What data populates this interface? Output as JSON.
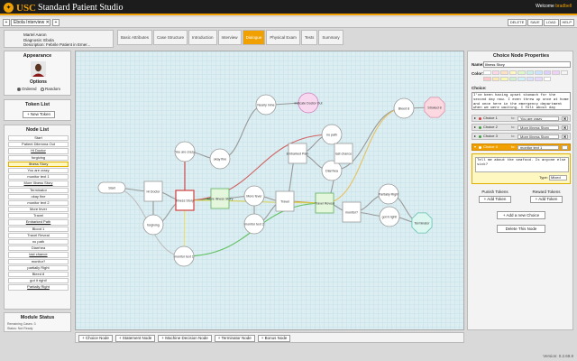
{
  "header": {
    "brand": "USC",
    "app_name": "Standard Patient Studio",
    "welcome_prefix": "Welcome",
    "username": "bradbell",
    "actions": [
      "DELETE",
      "SAVE",
      "LOAD",
      "HELP"
    ]
  },
  "scenario_tabs": {
    "add_label": "+",
    "current": "Ebola Interview",
    "current_marker": "✕",
    "new_label": "+"
  },
  "case_info": {
    "name": "Martel Aaron",
    "diagnosis": "Diagnosis: Ebola",
    "description": "Description: Febrile Patient in Emer..."
  },
  "section_tabs": [
    "Basic Attributes",
    "Case Structure",
    "Introduction",
    "Interview",
    "Dialogue",
    "Physical Exam",
    "Tests",
    "Summary"
  ],
  "active_section": "Dialogue",
  "left": {
    "appearance_title": "Appearance",
    "options_title": "Options",
    "option_ordered": "Ordered",
    "option_random": "Random",
    "tokens_title": "Token List",
    "new_token_label": "+ New Token",
    "node_list_title": "Node List",
    "nodes": [
      "Start",
      "Patient Dilemma Out",
      "Hi Doctor",
      "forgiving",
      "Illness Story",
      "You are crazy",
      "monitor text 1",
      "More Illness Story",
      "Terminator",
      "okay fine",
      "monitor text 2",
      "More fever",
      "Travel",
      "Embarked Path",
      "Blood 1",
      "Travel Reveal",
      "no path",
      "Diarrhea",
      "last chance",
      "monitor?",
      "partially Right",
      "Bleed 8",
      "got it right!",
      "Partially Right"
    ],
    "selected_node": "Illness Story",
    "module_status_title": "Module Status",
    "status_lines": [
      "Remaining Cases: 3",
      "Status: Not Ready"
    ]
  },
  "canvas": {
    "nodes": [
      {
        "label": "Start",
        "shape": "pill"
      },
      {
        "label": "Hi Doctor",
        "shape": "rect"
      },
      {
        "label": "forgiving",
        "shape": "circle"
      },
      {
        "label": "Illness Story",
        "shape": "rect-selected"
      },
      {
        "label": "You are crazy",
        "shape": "circle"
      },
      {
        "label": "okay fine",
        "shape": "circle"
      },
      {
        "label": "More Illness Story",
        "shape": "rect-green"
      },
      {
        "label": "monitor text 1",
        "shape": "circle"
      },
      {
        "label": "Nearly mine",
        "shape": "circle"
      },
      {
        "label": "Indicate Doctor Out",
        "shape": "circle-pink"
      },
      {
        "label": "More fever",
        "shape": "circle"
      },
      {
        "label": "monitor text 2",
        "shape": "circle"
      },
      {
        "label": "Travel",
        "shape": "rect"
      },
      {
        "label": "Embarked Path",
        "shape": "rect"
      },
      {
        "label": "no path",
        "shape": "circle"
      },
      {
        "label": "Diarrhea",
        "shape": "circle"
      },
      {
        "label": "last chance",
        "shape": "rect"
      },
      {
        "label": "Travel Reveal",
        "shape": "rect-green"
      },
      {
        "label": "monitor?",
        "shape": "rect"
      },
      {
        "label": "Bleed 8",
        "shape": "circle"
      },
      {
        "label": "Stroked 8",
        "shape": "oct-pink"
      },
      {
        "label": "Partially Right",
        "shape": "circle"
      },
      {
        "label": "Terminator",
        "shape": "oct-teal"
      },
      {
        "label": "got it right!",
        "shape": "circle"
      }
    ]
  },
  "bottom_buttons": [
    "+ Choice Node",
    "+ Statement Node",
    "+ Machine Decision Node",
    "+ Terminator Node",
    "+ Bonus Node"
  ],
  "right": {
    "title": "Choice Node Properties",
    "name_label": "Name:",
    "name_value": "Illness Story",
    "color_label": "Color:",
    "swatches": [
      "#ffffff",
      "#ffd6e8",
      "#ffe0c0",
      "#fff6c0",
      "#e0f6c8",
      "#c8f0e8",
      "#c8e4ff",
      "#dcd0ff",
      "#f0d0f8",
      "#f5f5f5",
      "#ffc8c8",
      "#ffe8b0",
      "#f8f8b0",
      "#d0f0d0",
      "#d0f0f8",
      "#d8e0ff",
      "#e8d8ff",
      "#ffffff"
    ],
    "choice_label": "Choice:",
    "choice_text": "I've been having upset stomach for the second day now. I even threw up once at home and once here in the emergency department when we were waiting. I felt about day",
    "choices": [
      {
        "label": "Choice 1",
        "to": "to:",
        "target": "You are crazy",
        "dot": "#d04040"
      },
      {
        "label": "Choice 2",
        "to": "to:",
        "target": "More Illness Story",
        "dot": "#40a040"
      },
      {
        "label": "Choice 3",
        "to": "to:",
        "target": "More Illness Story",
        "dot": "#40a040"
      },
      {
        "label": "Choice 4",
        "to": "to:",
        "target": "monitor text 1",
        "dot": "#ffffff"
      }
    ],
    "choice4_text": "Tell me about the seafood. Is anyone else sick?",
    "type_label": "Type:",
    "type_value": "Mixed",
    "punish_label": "Punish Tokens",
    "reward_label": "Reward Tokens",
    "add_token_label": "+ Add Token",
    "add_choice_label": "+ Add a new Choice",
    "delete_node_label": "Delete This Node"
  },
  "version": "Version: 0.2.69.8"
}
